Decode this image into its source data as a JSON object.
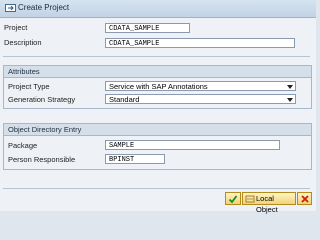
{
  "window": {
    "title": "Create Project"
  },
  "fields": {
    "project": {
      "label": "Project",
      "value": "CDATA_SAMPLE"
    },
    "description": {
      "label": "Description",
      "value": "CDATA_SAMPLE"
    }
  },
  "attributes": {
    "title": "Attributes",
    "project_type": {
      "label": "Project Type",
      "value": "Service with SAP Annotations"
    },
    "generation_strategy": {
      "label": "Generation Strategy",
      "value": "Standard"
    }
  },
  "object_directory": {
    "title": "Object Directory Entry",
    "package": {
      "label": "Package",
      "value": "SAMPLE"
    },
    "person_responsible": {
      "label": "Person Responsible",
      "value": "BPINST"
    }
  },
  "buttons": {
    "local_object_label": "Local Object"
  },
  "icons": {
    "title": "create-project-icon",
    "confirm": "check-icon",
    "local": "local-object-icon",
    "cancel": "cancel-icon"
  }
}
